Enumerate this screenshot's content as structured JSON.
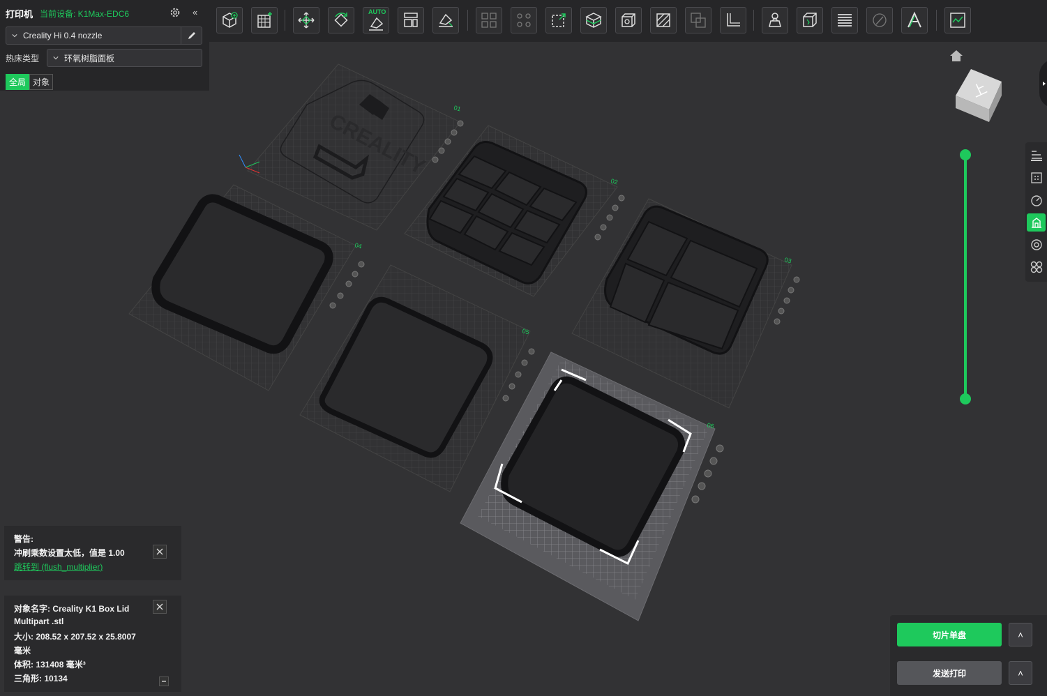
{
  "printer_panel": {
    "title": "打印机",
    "device": "当前设备: K1Max-EDC6",
    "nozzle": "Creality Hi 0.4 nozzle",
    "bed_label": "热床类型",
    "bed_value": "环氧树脂面板",
    "tab_global": "全局",
    "tab_object": "对象"
  },
  "toolbar": {
    "auto_label": "AUTO",
    "tools": [
      "add-object",
      "auto-arrange-plate",
      "move",
      "rotate",
      "auto-orient",
      "layout",
      "lay-on-face",
      "split-to-objects",
      "split-to-parts",
      "scale",
      "cut",
      "hollow",
      "support-paint",
      "boolean",
      "measure",
      "seam-paint",
      "shell",
      "layer-setting",
      "color-paint",
      "text",
      "assembly"
    ]
  },
  "plates": {
    "labels": [
      "01",
      "02",
      "03",
      "04",
      "05",
      "06"
    ]
  },
  "warning_panel": {
    "title": "警告:",
    "message": "冲刷乘数设置太低，值是 1.00",
    "link": "跳转到 (flush_multiplier)"
  },
  "object_panel": {
    "name_line1": "对象名字:  Creality K1 Box Lid",
    "name_line2": "Multipart .stl",
    "size_line1": "大小:   208.52 x 207.52 x 25.8007",
    "size_line2": "毫米",
    "volume": "体积:   131408 毫米³",
    "triangles": "三角形:  10134"
  },
  "actions": {
    "slice_label": "切片单盘",
    "send_label": "发送打印",
    "caret": "˄"
  },
  "view_cube_face": "上",
  "accent_color": "#1ec95c"
}
